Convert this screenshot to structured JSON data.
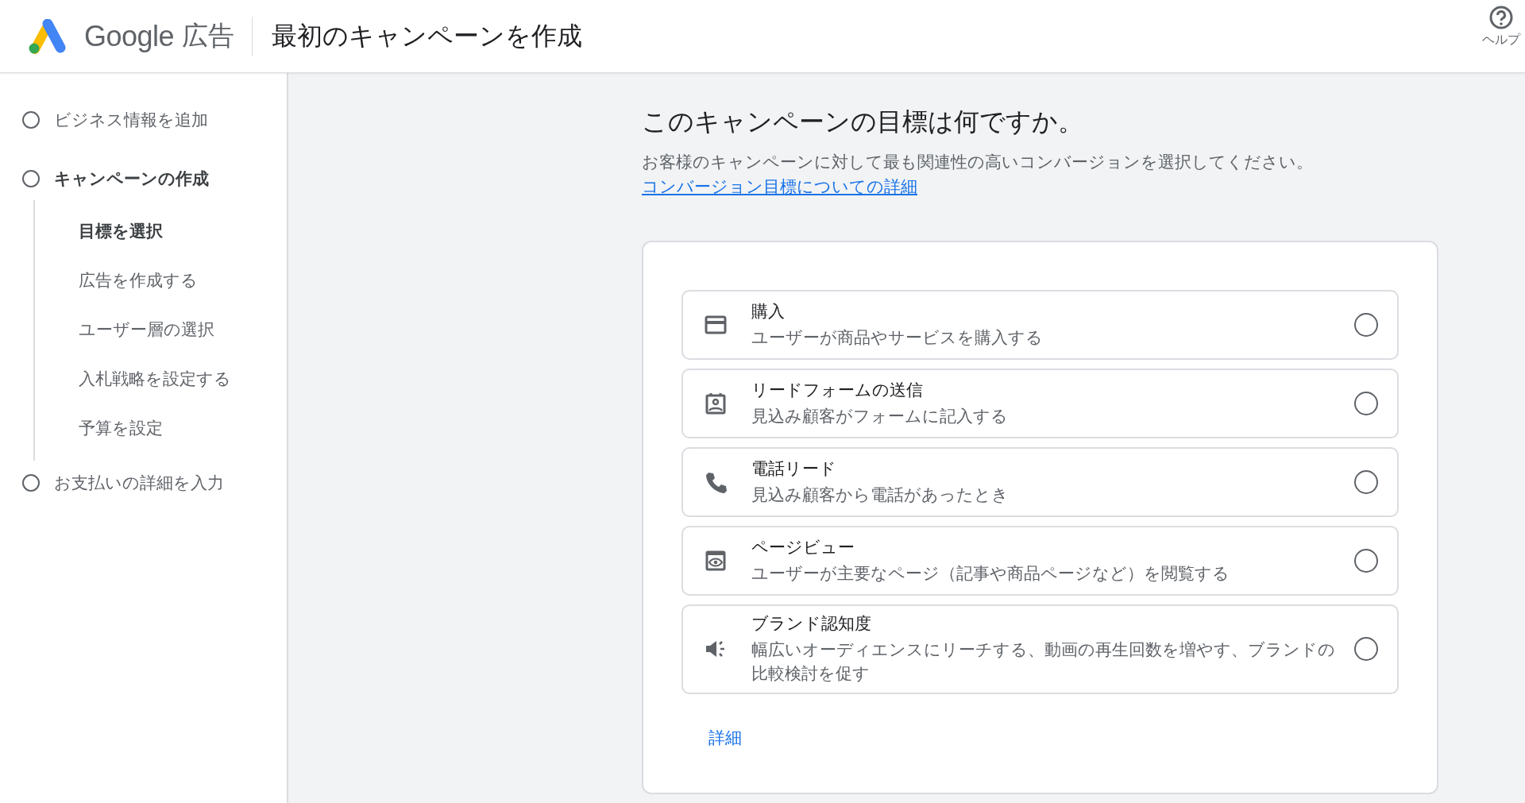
{
  "header": {
    "brand": "Google",
    "product": "広告",
    "title": "最初のキャンペーンを作成",
    "help": "ヘルプ"
  },
  "sidebar": {
    "steps": [
      {
        "label": "ビジネス情報を追加",
        "selected": false
      },
      {
        "label": "キャンペーンの作成",
        "selected": true,
        "children": [
          {
            "label": "目標を選択",
            "selected": true
          },
          {
            "label": "広告を作成する",
            "selected": false
          },
          {
            "label": "ユーザー層の選択",
            "selected": false
          },
          {
            "label": "入札戦略を設定する",
            "selected": false
          },
          {
            "label": "予算を設定",
            "selected": false
          }
        ]
      },
      {
        "label": "お支払いの詳細を入力",
        "selected": false
      }
    ]
  },
  "main": {
    "heading": "このキャンペーンの目標は何ですか。",
    "description": "お客様のキャンペーンに対して最も関連性の高いコンバージョンを選択してください。",
    "description_link": "コンバージョン目標についての詳細",
    "goals": [
      {
        "title": "購入",
        "description": "ユーザーが商品やサービスを購入する",
        "selected": false
      },
      {
        "title": "リードフォームの送信",
        "description": "見込み顧客がフォームに記入する",
        "selected": false
      },
      {
        "title": "電話リード",
        "description": "見込み顧客から電話があったとき",
        "selected": false
      },
      {
        "title": "ページビュー",
        "description": "ユーザーが主要なページ（記事や商品ページなど）を閲覧する",
        "selected": false
      },
      {
        "title": "ブランド認知度",
        "description": "幅広いオーディエンスにリーチする、動画の再生回数を増やす、ブランドの比較検討を促す",
        "selected": false
      }
    ],
    "more_link": "詳細"
  }
}
